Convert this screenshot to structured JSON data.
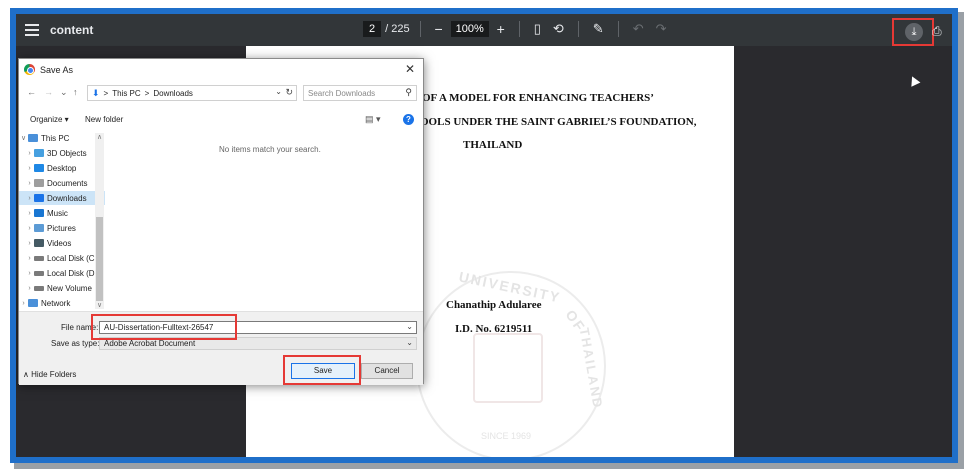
{
  "viewer": {
    "title": "content",
    "current_page": "2",
    "page_total": "/ 225",
    "zoom": "100%",
    "zoom_out": "−",
    "zoom_in": "+",
    "menu_icon": "hamburger-icon",
    "fit_icon": "fit-page-icon",
    "rotate_icon": "rotate-icon",
    "annotate_icon": "draw-icon",
    "undo_icon": "undo-icon",
    "redo_icon": "redo-icon",
    "download_icon": "download-icon",
    "print_icon": "print-icon",
    "highlight_color": "#e53935"
  },
  "pdf": {
    "line1": "OF A MODEL FOR ENHANCING TEACHERS’",
    "line2": "OOLS UNDER THE SAINT GABRIEL’S FOUNDATION,",
    "line3": "THAILAND",
    "author": "Chanathip Adularee",
    "id": "I.D. No. 6219511",
    "seal_word1": "UNIVERSITY",
    "seal_word2": "OF",
    "seal_word3": "THAILAND",
    "seal_year": "SINCE 1969"
  },
  "dialog": {
    "title": "Save As",
    "close": "✕",
    "breadcrumb_root": "This PC",
    "breadcrumb_sep": ">",
    "breadcrumb_folder": "Downloads",
    "search_placeholder": "Search Downloads",
    "organize": "Organize ▾",
    "new_folder": "New folder",
    "empty_message": "No items match your search.",
    "nav_items": [
      {
        "label": "This PC",
        "color": "#4a90d9"
      },
      {
        "label": "3D Objects",
        "color": "#46a0e0"
      },
      {
        "label": "Desktop",
        "color": "#1e88e5"
      },
      {
        "label": "Documents",
        "color": "#9e9e9e"
      },
      {
        "label": "Downloads",
        "color": "#1a73e8"
      },
      {
        "label": "Music",
        "color": "#1976d2"
      },
      {
        "label": "Pictures",
        "color": "#5c9bd5"
      },
      {
        "label": "Videos",
        "color": "#455a64"
      },
      {
        "label": "Local Disk (C",
        "color": "#7a7a7a"
      },
      {
        "label": "Local Disk (D",
        "color": "#7a7a7a"
      },
      {
        "label": "New Volume",
        "color": "#7a7a7a"
      },
      {
        "label": "Network",
        "color": "#4a90d9"
      }
    ],
    "file_name_label": "File name:",
    "file_name_value": "AU-Dissertation-Fulltext-26547",
    "save_type_label": "Save as type:",
    "save_type_value": "Adobe Acrobat Document",
    "hide_folders": "Hide Folders",
    "save": "Save",
    "cancel": "Cancel"
  }
}
